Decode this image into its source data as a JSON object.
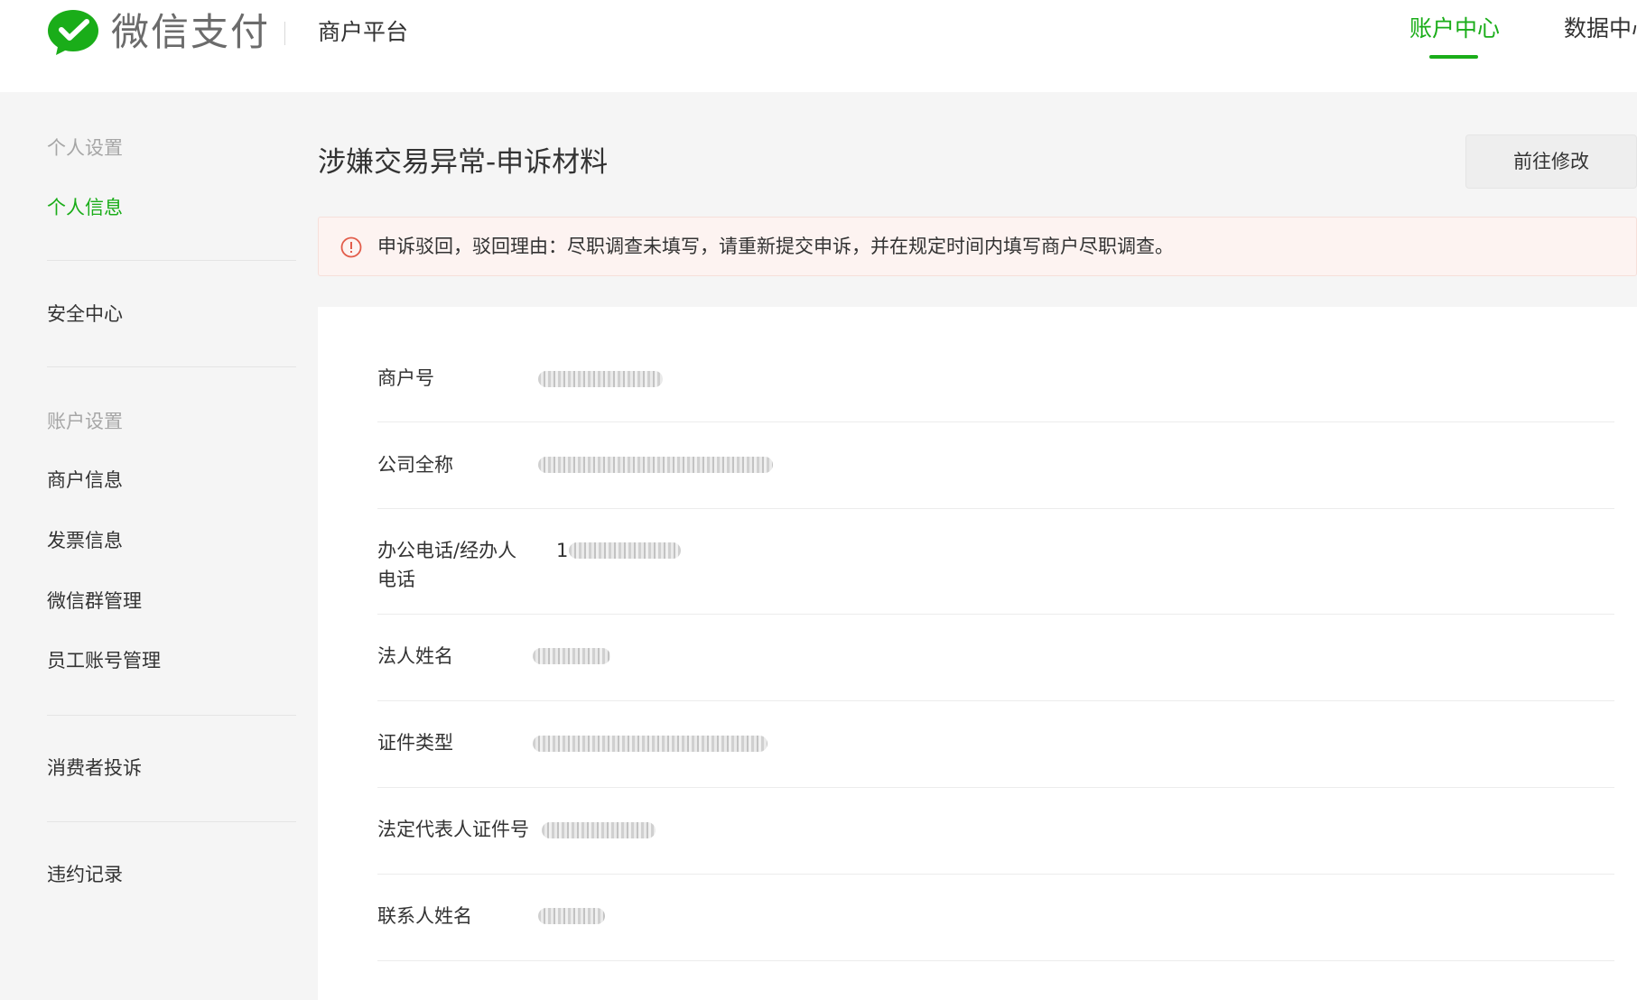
{
  "header": {
    "brand": "微信支付",
    "platform": "商户平台",
    "nav": [
      {
        "label": "账户中心",
        "active": true
      },
      {
        "label": "数据中心",
        "active": false
      }
    ],
    "accent_color": "#1aad19"
  },
  "sidebar": {
    "groups": [
      {
        "title": "个人设置",
        "items": [
          "个人信息"
        ]
      },
      {
        "title": "",
        "items": [
          "安全中心"
        ]
      },
      {
        "title": "账户设置",
        "items": [
          "商户信息",
          "发票信息",
          "微信群管理",
          "员工账号管理"
        ]
      },
      {
        "title": "",
        "items": [
          "消费者投诉"
        ]
      },
      {
        "title": "",
        "items": [
          "违约记录"
        ]
      }
    ],
    "active_item": "个人信息"
  },
  "main": {
    "title": "涉嫌交易异常-申诉材料",
    "edit_button": "前往修改",
    "alert": {
      "icon": "exclamation-circle-icon",
      "text": "申诉驳回，驳回理由：尽职调查未填写，请重新提交申诉，并在规定时间内填写商户尽职调查。"
    },
    "fields": [
      {
        "label": "商户号",
        "value": "",
        "redacted": true
      },
      {
        "label": "公司全称",
        "value": "",
        "redacted": true
      },
      {
        "label_line1": "办公电话/经办人",
        "label_line2": "电话",
        "value": "1",
        "redacted": true
      },
      {
        "label": "法人姓名",
        "value": "",
        "redacted": true
      },
      {
        "label": "证件类型",
        "value": "",
        "redacted": true
      },
      {
        "label": "法定代表人证件号",
        "value": "",
        "redacted": true
      },
      {
        "label": "联系人姓名",
        "value": "",
        "redacted": true
      }
    ]
  }
}
